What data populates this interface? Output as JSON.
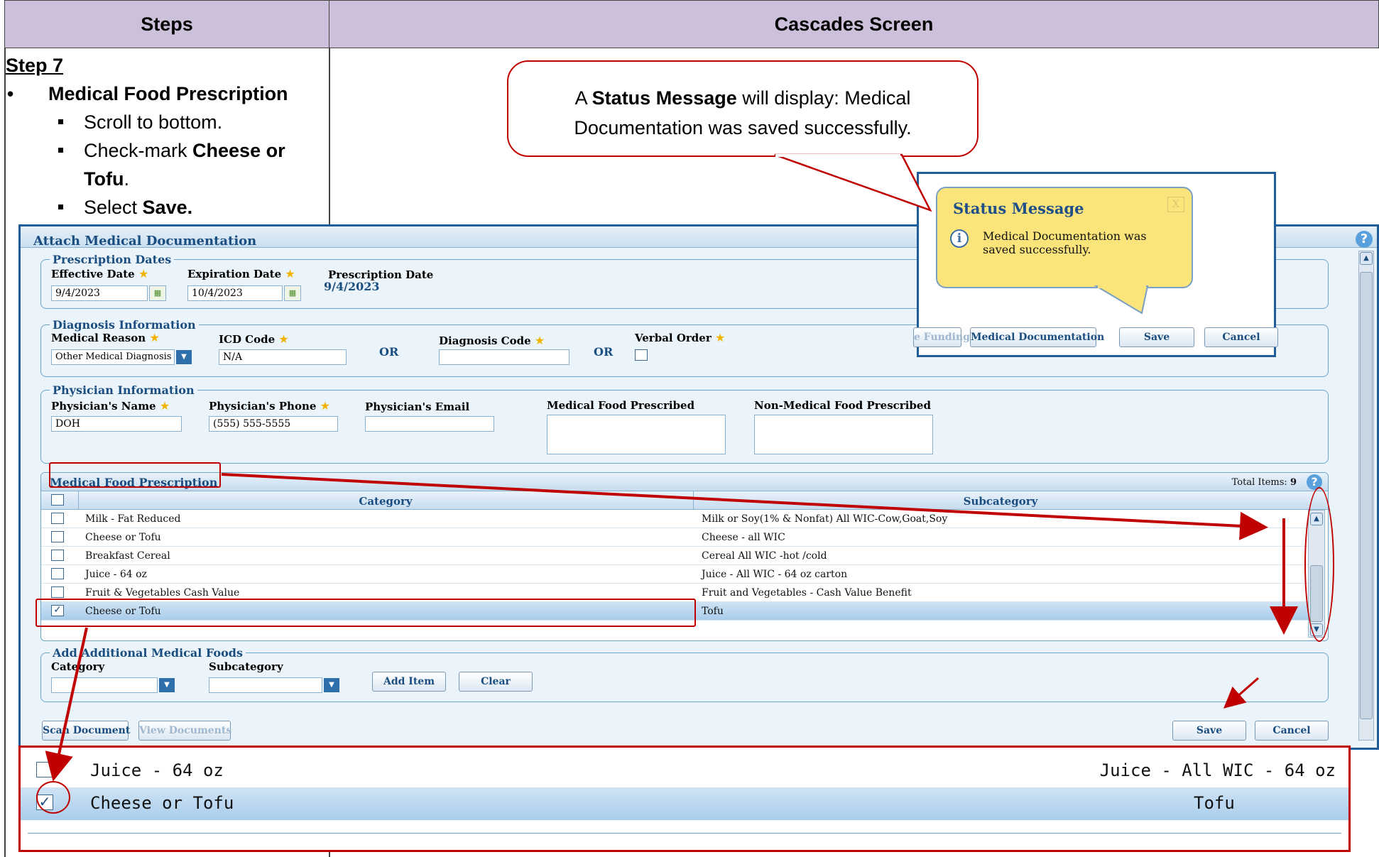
{
  "headers": {
    "steps": "Steps",
    "screen": "Cascades Screen"
  },
  "steps": {
    "title": "Step 7",
    "bullet": "Medical Food Prescription",
    "sub1": "Scroll to bottom.",
    "sub2_pre": "Check-mark ",
    "sub2_bold1": "Cheese or",
    "sub2_bold2": "Tofu",
    "sub2_post": ".",
    "sub3_pre": "Select ",
    "sub3_bold": "Save."
  },
  "callout": {
    "pre": "A ",
    "bold": "Status Message",
    "post": " will display: Medical",
    "line2": "Documentation was saved successfully."
  },
  "panel": {
    "title": "Attach Medical Documentation",
    "help": "?",
    "prescription_dates": {
      "legend": "Prescription Dates",
      "effective_label": "Effective Date",
      "effective_value": "9/4/2023",
      "expiration_label": "Expiration Date",
      "expiration_value": "10/4/2023",
      "prescription_label": "Prescription Date",
      "prescription_value": "9/4/2023"
    },
    "diagnosis": {
      "legend": "Diagnosis Information",
      "reason_label": "Medical Reason",
      "reason_value": "Other Medical Diagnosis",
      "icd_label": "ICD Code",
      "icd_value": "N/A",
      "or": "OR",
      "code_label": "Diagnosis Code",
      "code_value": "",
      "verbal_label": "Verbal Order"
    },
    "physician": {
      "legend": "Physician Information",
      "name_label": "Physician's Name",
      "name_value": "DOH",
      "phone_label": "Physician's Phone",
      "phone_value": "(555) 555-5555",
      "email_label": "Physician's Email",
      "email_value": "",
      "medical_food_label": "Medical Food Prescribed",
      "non_medical_food_label": "Non-Medical Food Prescribed"
    },
    "grid": {
      "title": "Medical Food Prescription",
      "total_label": "Total Items:",
      "total_value": "9",
      "col_category": "Category",
      "col_subcategory": "Subcategory",
      "rows": [
        {
          "checked": false,
          "category": "Milk - Fat Reduced",
          "subcategory": "Milk or Soy(1% & Nonfat) All WIC-Cow,Goat,Soy"
        },
        {
          "checked": false,
          "category": "Cheese or Tofu",
          "subcategory": "Cheese - all WIC"
        },
        {
          "checked": false,
          "category": "Breakfast Cereal",
          "subcategory": "Cereal All WIC -hot /cold"
        },
        {
          "checked": false,
          "category": "Juice - 64 oz",
          "subcategory": "Juice - All WIC - 64 oz carton"
        },
        {
          "checked": false,
          "category": "Fruit & Vegetables Cash Value",
          "subcategory": "Fruit and Vegetables - Cash Value Benefit"
        },
        {
          "checked": true,
          "category": "Cheese or Tofu",
          "subcategory": "Tofu"
        }
      ]
    },
    "additional": {
      "legend": "Add Additional Medical Foods",
      "category_label": "Category",
      "subcategory_label": "Subcategory",
      "add_button": "Add Item",
      "clear_button": "Clear"
    },
    "scan_button": "Scan Document",
    "view_button": "View Documents",
    "save_button": "Save",
    "cancel_button": "Cancel"
  },
  "popup": {
    "title": "Status Message",
    "close": "X",
    "message": "Medical Documentation was saved successfully.",
    "funding_button": "e Funding",
    "meddoc_button": "Medical Documentation",
    "save_button": "Save",
    "cancel_button": "Cancel"
  },
  "zoom": {
    "row1_category": "Juice - 64 oz",
    "row1_subcategory": "Juice - All WIC - 64 oz",
    "row2_category": "Cheese or Tofu",
    "row2_subcategory": "Tofu"
  },
  "colors": {
    "header_bg": "#ccc0da",
    "annotation_red": "#c00000",
    "panel_border": "#1f5c99",
    "bubble_yellow": "#fbe57b"
  }
}
